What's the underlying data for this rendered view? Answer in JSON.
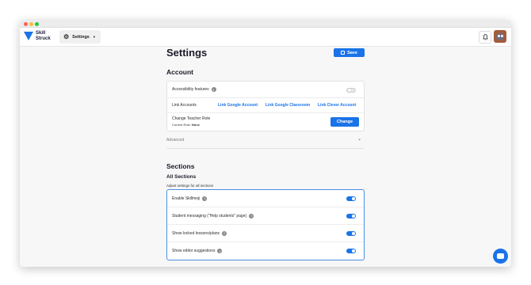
{
  "nav": {
    "logo_text": "Skill\nStruck",
    "settings_label": "Settings"
  },
  "page": {
    "title": "Settings",
    "save_label": "Save"
  },
  "account": {
    "title": "Account",
    "accessibility_label": "Accessibility features",
    "accessibility_on": false,
    "link_accounts_label": "Link Accounts",
    "links": [
      "Link Google Account",
      "Link Google Classroom",
      "Link Clever Account"
    ],
    "teacher_role_label": "Change Teacher Role",
    "current_role_prefix": "Current Role:",
    "current_role_value": "None",
    "change_label": "Change",
    "advanced_label": "Advanced"
  },
  "sections": {
    "title": "Sections",
    "all_title": "All Sections",
    "helper": "Adjust settings for all sections",
    "items": [
      {
        "label": "Enable Skillmoji",
        "on": true
      },
      {
        "label": "Student messaging (\"Help students\" page)",
        "on": true
      },
      {
        "label": "Show locked lessons/plans",
        "on": true
      },
      {
        "label": "Show editor suggestions",
        "on": true
      }
    ]
  },
  "colors": {
    "accent": "#1a73e8"
  },
  "icons": {
    "settings": "gear-icon",
    "notifications": "bell-icon",
    "save": "floppy-icon",
    "advanced": "chevron-down-icon",
    "chat": "chat-icon"
  }
}
